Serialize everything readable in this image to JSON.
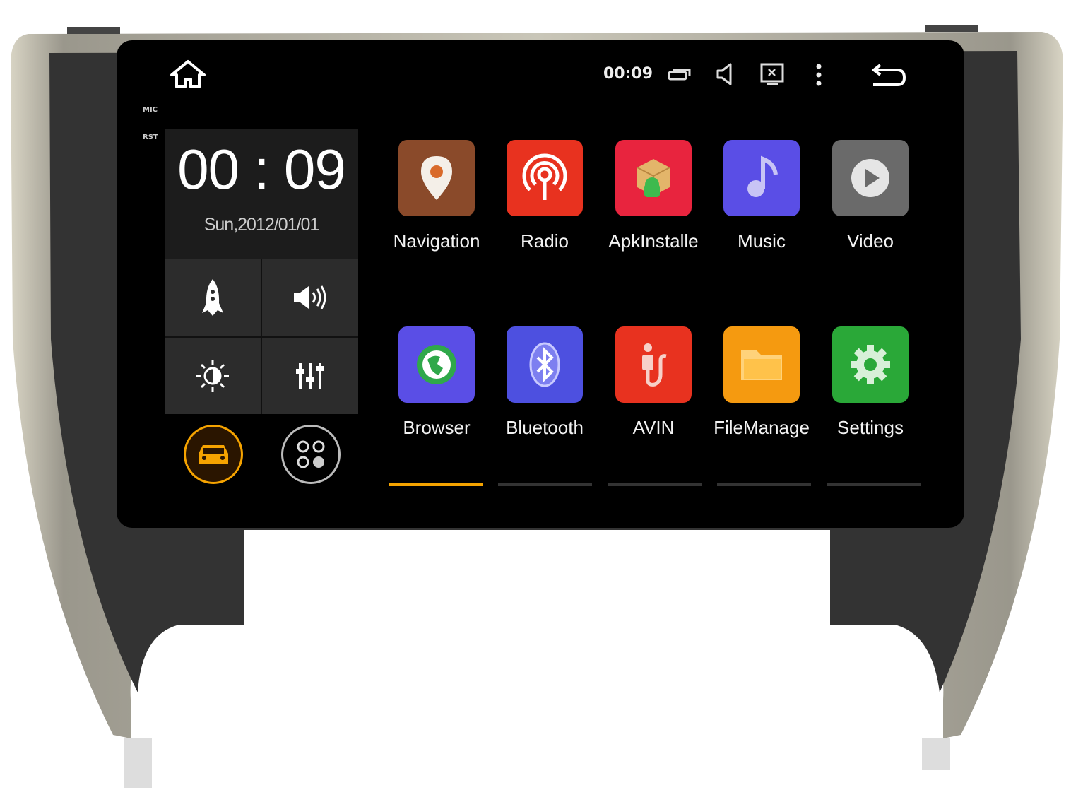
{
  "status_bar": {
    "time": "00:09",
    "icons": [
      "home-icon",
      "recent-apps-icon",
      "volume-icon",
      "screenshot-icon",
      "more-vert-icon",
      "back-icon"
    ]
  },
  "hardware_labels": {
    "mic": "MIC",
    "rst": "RST"
  },
  "clock_widget": {
    "time": "00 : 09",
    "date": "Sun,2012/01/01"
  },
  "quick_controls": [
    {
      "name": "boost",
      "icon": "rocket-icon"
    },
    {
      "name": "volume",
      "icon": "speaker-icon"
    },
    {
      "name": "brightness",
      "icon": "brightness-icon"
    },
    {
      "name": "equalizer",
      "icon": "equalizer-icon"
    }
  ],
  "bottom_buttons": [
    {
      "name": "car",
      "icon": "car-icon",
      "color": "#f5a300"
    },
    {
      "name": "all-apps",
      "icon": "apps-grid-icon",
      "color": "#bbbbbb"
    }
  ],
  "apps": [
    {
      "label": "Navigation",
      "icon": "location-pin-icon",
      "color": "#8a4a2a"
    },
    {
      "label": "Radio",
      "icon": "radio-broadcast-icon",
      "color": "#e8321f"
    },
    {
      "label": "ApkInstalle",
      "icon": "package-android-icon",
      "color": "#e8243e"
    },
    {
      "label": "Music",
      "icon": "music-note-icon",
      "color": "#5a4ee6"
    },
    {
      "label": "Video",
      "icon": "play-icon",
      "color": "#6a6a6a"
    },
    {
      "label": "Browser",
      "icon": "globe-icon",
      "color": "#5a4ee6"
    },
    {
      "label": "Bluetooth",
      "icon": "bluetooth-icon",
      "color": "#4d50e0"
    },
    {
      "label": "AVIN",
      "icon": "avin-plug-icon",
      "color": "#e8321f"
    },
    {
      "label": "FileManage",
      "icon": "folder-icon",
      "color": "#f59a10"
    },
    {
      "label": "Settings",
      "icon": "gear-icon",
      "color": "#2aa838"
    }
  ],
  "pager": {
    "pages": 5,
    "active": 1,
    "active_color": "#f5a300"
  }
}
